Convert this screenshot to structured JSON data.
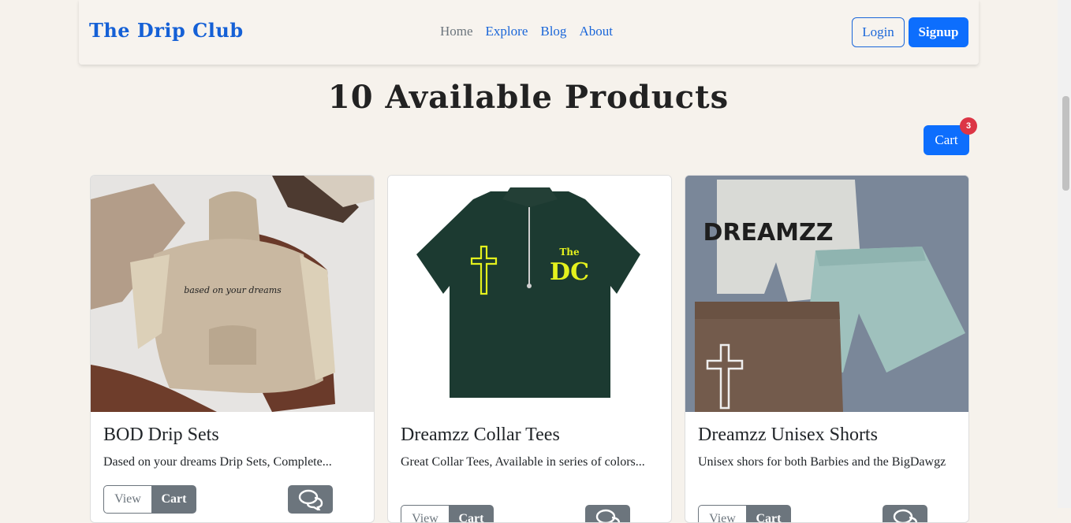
{
  "nav": {
    "brand": "The Drip Club",
    "links": [
      "Home",
      "Explore",
      "Blog",
      "About"
    ],
    "login": "Login",
    "signup": "Signup"
  },
  "page": {
    "title": "10 Available Products",
    "cart_label": "Cart",
    "cart_count": "3"
  },
  "products": [
    {
      "title": "BOD Drip Sets",
      "desc": "Dased on your dreams Drip Sets, Complete...",
      "view": "View",
      "cart": "Cart",
      "image_text": "based on your dreams"
    },
    {
      "title": "Dreamzz Collar Tees",
      "desc": "Great Collar Tees, Available in series of colors...",
      "view": "View",
      "cart": "Cart",
      "image_text": "The DC"
    },
    {
      "title": "Dreamzz Unisex Shorts",
      "desc": "Unisex shors for both Barbies and the BigDawgz",
      "view": "View",
      "cart": "Cart",
      "image_text": "DREAMZZ"
    }
  ],
  "colors": {
    "primary": "#0d6efd",
    "secondary": "#6c757d",
    "badge": "#dc3545",
    "background": "#f6f2ec"
  },
  "icons": [
    "comments-icon"
  ]
}
